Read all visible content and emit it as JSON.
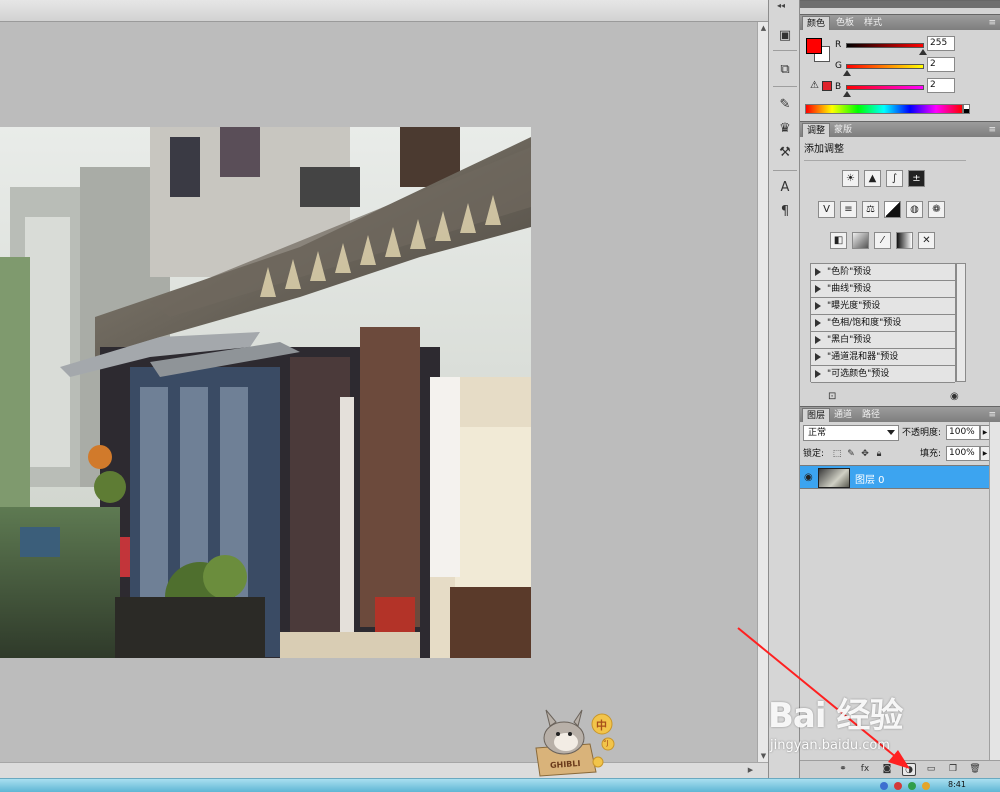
{
  "panels": {
    "color": {
      "tabs": [
        "颜色",
        "色板",
        "样式"
      ],
      "active_tab": 0,
      "fg_color": "#ff0000",
      "bg_color": "#ffffff",
      "channels": [
        {
          "label": "R",
          "value": "255"
        },
        {
          "label": "G",
          "value": "2"
        },
        {
          "label": "B",
          "value": "2"
        }
      ]
    },
    "adjustments": {
      "tabs": [
        "调整",
        "蒙版"
      ],
      "active_tab": 0,
      "title": "添加调整",
      "icons_row1": [
        "brightness-contrast-icon",
        "levels-icon",
        "curves-icon",
        "exposure-icon"
      ],
      "icons_row2": [
        "vibrance-icon",
        "hue-saturation-icon",
        "color-balance-icon",
        "black-white-icon",
        "photo-filter-icon",
        "channel-mixer-icon"
      ],
      "icons_row3": [
        "invert-icon",
        "posterize-icon",
        "threshold-icon",
        "gradient-map-icon",
        "selective-color-icon"
      ],
      "presets": [
        "\"色阶\"预设",
        "\"曲线\"预设",
        "\"曝光度\"预设",
        "\"色相/饱和度\"预设",
        "\"黑白\"预设",
        "\"通道混和器\"预设",
        "\"可选颜色\"预设"
      ]
    },
    "layers": {
      "tabs": [
        "图层",
        "通道",
        "路径"
      ],
      "active_tab": 0,
      "blend_mode": "正常",
      "opacity_label": "不透明度:",
      "opacity_value": "100%",
      "lock_label": "锁定:",
      "fill_label": "填充:",
      "fill_value": "100%",
      "layer_name": "图层 0"
    }
  },
  "taskbar": {
    "clock": "8:41"
  },
  "watermark": {
    "brand": "Bai 经验",
    "url": "jingyan.baidu.com"
  },
  "mascot": {
    "text": "GHIBLI",
    "bubble1": "中",
    "bubble2": "°J"
  },
  "annotation": {
    "arrow_color": "#ff2020"
  }
}
